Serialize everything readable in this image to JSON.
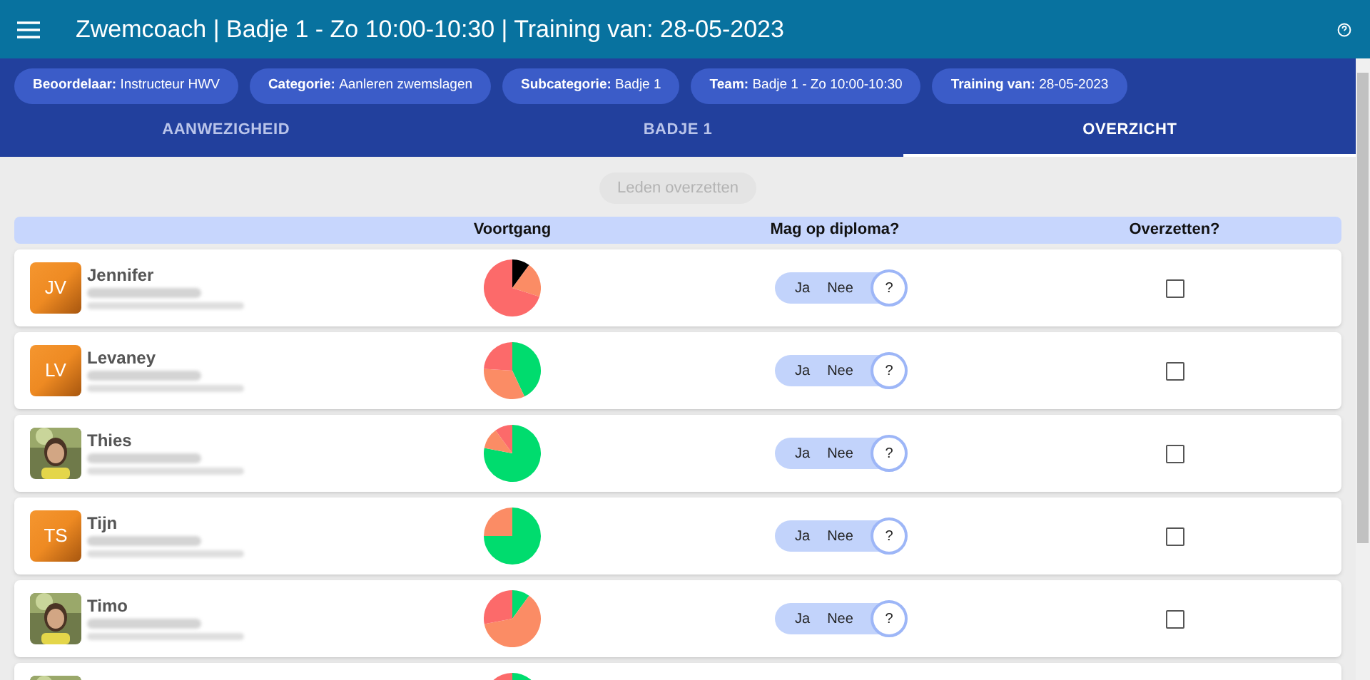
{
  "app_bar": {
    "title": "Zwemcoach | Badje 1 - Zo 10:00-10:30 | Training van: 28-05-2023"
  },
  "chips": [
    {
      "label": "Beoordelaar:",
      "value": "Instructeur HWV"
    },
    {
      "label": "Categorie:",
      "value": "Aanleren zwemslagen"
    },
    {
      "label": "Subcategorie:",
      "value": "Badje 1"
    },
    {
      "label": "Team:",
      "value": "Badje 1 - Zo 10:00-10:30"
    },
    {
      "label": "Training van:",
      "value": "28-05-2023"
    }
  ],
  "tabs": [
    {
      "label": "AANWEZIGHEID",
      "selected": false
    },
    {
      "label": "BADJE 1",
      "selected": false
    },
    {
      "label": "OVERZICHT",
      "selected": true
    }
  ],
  "action_button": {
    "label": "Leden overzetten",
    "disabled": true
  },
  "table": {
    "columns": [
      "Voortgang",
      "Mag op diploma?",
      "Overzetten?"
    ],
    "rows": [
      {
        "avatar": {
          "kind": "initials",
          "initials": "JV"
        },
        "name": "Jennifer",
        "diploma": [
          {
            "label": "Ja",
            "selected": false
          },
          {
            "label": "Nee",
            "selected": false
          },
          {
            "label": "?",
            "selected": true
          }
        ],
        "transfer_checked": false
      },
      {
        "avatar": {
          "kind": "initials",
          "initials": "LV"
        },
        "name": "Levaney",
        "diploma": [
          {
            "label": "Ja",
            "selected": false
          },
          {
            "label": "Nee",
            "selected": false
          },
          {
            "label": "?",
            "selected": true
          }
        ],
        "transfer_checked": false
      },
      {
        "name": "Thies",
        "diploma": [
          {
            "label": "Ja",
            "selected": false
          },
          {
            "label": "Nee",
            "selected": false
          },
          {
            "label": "?",
            "selected": true
          }
        ],
        "transfer_checked": false
      },
      {
        "avatar": {
          "kind": "initials",
          "initials": "TS"
        },
        "name": "Tijn",
        "diploma": [
          {
            "label": "Ja",
            "selected": false
          },
          {
            "label": "Nee",
            "selected": false
          },
          {
            "label": "?",
            "selected": true
          }
        ],
        "transfer_checked": false
      },
      {
        "name": "Timo",
        "diploma": [
          {
            "label": "Ja",
            "selected": false
          },
          {
            "label": "Nee",
            "selected": false
          },
          {
            "label": "?",
            "selected": true
          }
        ],
        "transfer_checked": false
      }
    ]
  }
}
